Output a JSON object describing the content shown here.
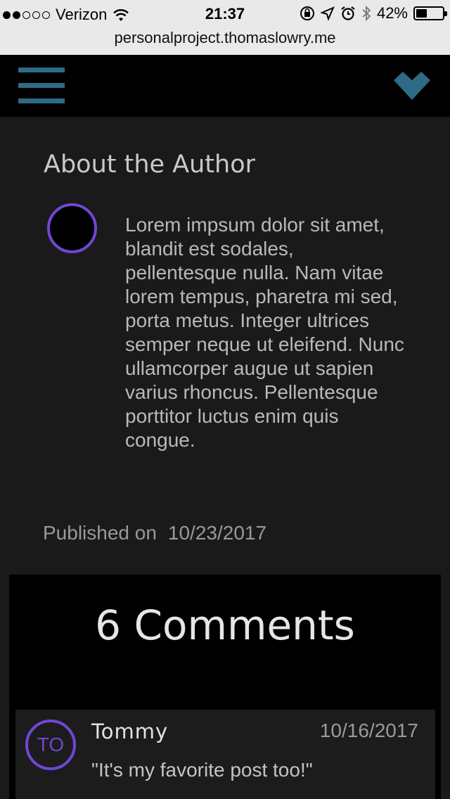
{
  "status_bar": {
    "carrier": "Verizon",
    "time": "21:37",
    "battery_percent": "42%",
    "battery_level": 0.42,
    "signal_dots": [
      true,
      true,
      false,
      false,
      false
    ],
    "icons": [
      "wifi-icon",
      "orientation-lock-icon",
      "location-icon",
      "alarm-icon",
      "bluetooth-icon",
      "battery-icon"
    ]
  },
  "browser": {
    "url": "personalproject.thomaslowry.me"
  },
  "nav": {
    "menu_icon": "hamburger-menu-icon",
    "logo_icon": "chevron-down-logo-icon",
    "accent_color": "#2e6b86"
  },
  "author": {
    "heading": "About the Author",
    "bio": "Lorem impsum dolor sit amet, blandit est sodales, pellentesque nulla. Nam vitae lorem tempus, pharetra mi sed, porta metus. Integer ultrices semper neque ut eleifend. Nunc ullamcorper augue ut sapien varius rhoncus. Pellentesque porttitor luctus enim quis congue.",
    "published_label": "Published on",
    "published_date": "10/23/2017",
    "avatar_ring_color": "#7046d6"
  },
  "comments": {
    "count_label": "6 Comments",
    "items": [
      {
        "initials": "TO",
        "author": "Tommy",
        "date": "10/16/2017",
        "text": "\"It's my favorite post too!\""
      }
    ]
  }
}
